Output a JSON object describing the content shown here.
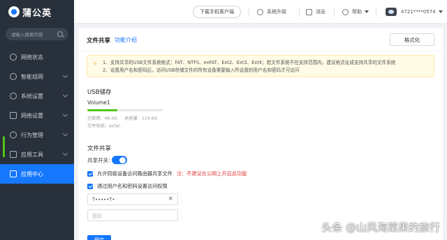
{
  "app": {
    "brand": "蒲公英",
    "search_placeholder": "请输入搜索内容"
  },
  "sidebar": {
    "items": [
      {
        "label": "网络状态",
        "icon": "network-status-icon"
      },
      {
        "label": "智能组网",
        "icon": "smart-network-icon"
      },
      {
        "label": "系统设置",
        "icon": "system-settings-icon"
      },
      {
        "label": "网络设置",
        "icon": "network-settings-icon"
      },
      {
        "label": "行为管理",
        "icon": "behavior-management-icon"
      },
      {
        "label": "应用工具",
        "icon": "app-tools-icon"
      },
      {
        "label": "应用中心",
        "icon": "app-center-icon",
        "active": true
      }
    ]
  },
  "topbar": {
    "download_label": "下载手机客户端",
    "upgrade_label": "系统升级",
    "message_label": "消息",
    "help_label": "帮助",
    "device_id": "4721****0574"
  },
  "page": {
    "title": "文件共享",
    "intro_link": "功能介绍",
    "format_button": "格式化",
    "notice_line1": "1、支持共享的USB文件系统格式：FAT、NTFS、exFAT、Ext2、Ext3、Ext4；若文件系统不在支持范围内，建议格式化成支持共享的文件系统",
    "notice_line2": "2、设置用户名和密码后，访问USB存储文件的所有设备需要输入所设置的用户名和密码才可访问",
    "usb_section": "USB储存",
    "volume_name": "Volume1",
    "used_fraction": 0.4,
    "used_label": "已使用:",
    "used_value": "46.0G",
    "total_label": "总容量:",
    "total_value": "114.6G",
    "fs_label": "文件系统:",
    "fs_value": "exfat",
    "share_section": "文件共享",
    "share_switch_label": "共享开关:",
    "share_on": true,
    "allow_router_label": "允许同级设备访问路由器共享文件",
    "allow_router_warning": "注：不建议在公网上开启此功能",
    "auth_label": "通过用户名和密码设置访问权限",
    "username_value": "T•••••T•",
    "password_placeholder": "密码",
    "save_button": "保存"
  },
  "watermark": "头条 @山风海棠果的旅行",
  "colors": {
    "accent": "#1677ff",
    "sidebar_bg": "#28303b",
    "warning": "#e23c3c",
    "usage_bar": "#52c41a"
  }
}
